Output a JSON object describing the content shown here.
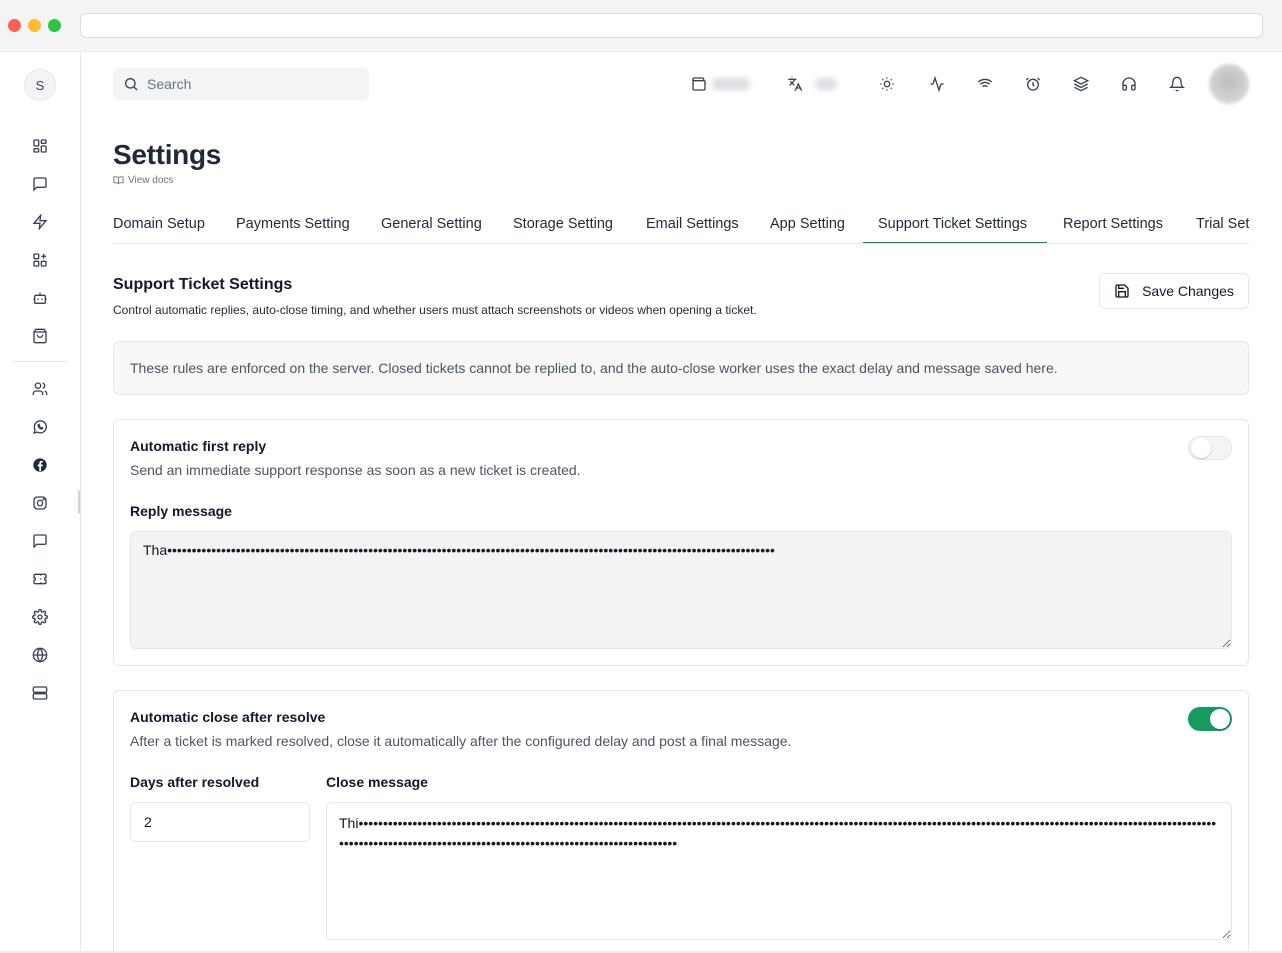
{
  "browser": {
    "url": ""
  },
  "sidebar": {
    "user_initial": "S",
    "icons": [
      "dashboard-icon",
      "chat-icon",
      "lightning-icon",
      "apps-add-icon",
      "bot-icon",
      "shopping-bag-icon",
      "users-icon",
      "whatsapp-icon",
      "facebook-icon",
      "instagram-icon",
      "message-icon",
      "ticket-icon",
      "settings-icon",
      "globe-icon",
      "server-icon"
    ]
  },
  "topbar": {
    "search_placeholder": "Search",
    "icons": [
      "wallet-icon",
      "translate-icon",
      "sun-icon",
      "activity-icon",
      "wifi-icon",
      "alarm-icon",
      "layers-icon",
      "headset-icon",
      "bell-icon"
    ]
  },
  "header": {
    "title": "Settings",
    "docs_link": "View docs"
  },
  "tabs": [
    {
      "label": "Domain Setup"
    },
    {
      "label": "Payments Setting"
    },
    {
      "label": "General Setting"
    },
    {
      "label": "Storage Setting"
    },
    {
      "label": "Email Settings"
    },
    {
      "label": "App Setting"
    },
    {
      "label": "Support Ticket Settings",
      "active": true
    },
    {
      "label": "Report Settings"
    },
    {
      "label": "Trial Set"
    }
  ],
  "section": {
    "title": "Support Ticket Settings",
    "description": "Control automatic replies, auto-close timing, and whether users must attach screenshots or videos when opening a ticket.",
    "save_label": "Save Changes",
    "notice": "These rules are enforced on the server. Closed tickets cannot be replied to, and the auto-close worker uses the exact delay and message saved here."
  },
  "auto_reply": {
    "title": "Automatic first reply",
    "description": "Send an immediate support response as soon as a new ticket is created.",
    "enabled": false,
    "message_label": "Reply message",
    "message_value": "Tha••••••••••••••••••••••••••••••••••••••••••••••••••••••••••••••••••••••••••••••••••••••••••••••••••••••••••••••••••••••••••••"
  },
  "auto_close": {
    "title": "Automatic close after resolve",
    "description": "After a ticket is marked resolved, close it automatically after the configured delay and post a final message.",
    "enabled": true,
    "days_label": "Days after resolved",
    "days_value": "2",
    "message_label": "Close message",
    "message_value": "Thi••••••••••••••••••••••••••••••••••••••••••••••••••••••••••••••••••••••••••••••••••••••••••••••••••••••••••••••••••••••••••••••••••••••••••••••••••••••••••••••••••••••••••••••••••••••••••••••••••••••••••••••••••••••••••••••••••••••••••••••••••••"
  },
  "colors": {
    "accent": "#0f8a6a",
    "toggle_on": "#179a60"
  }
}
